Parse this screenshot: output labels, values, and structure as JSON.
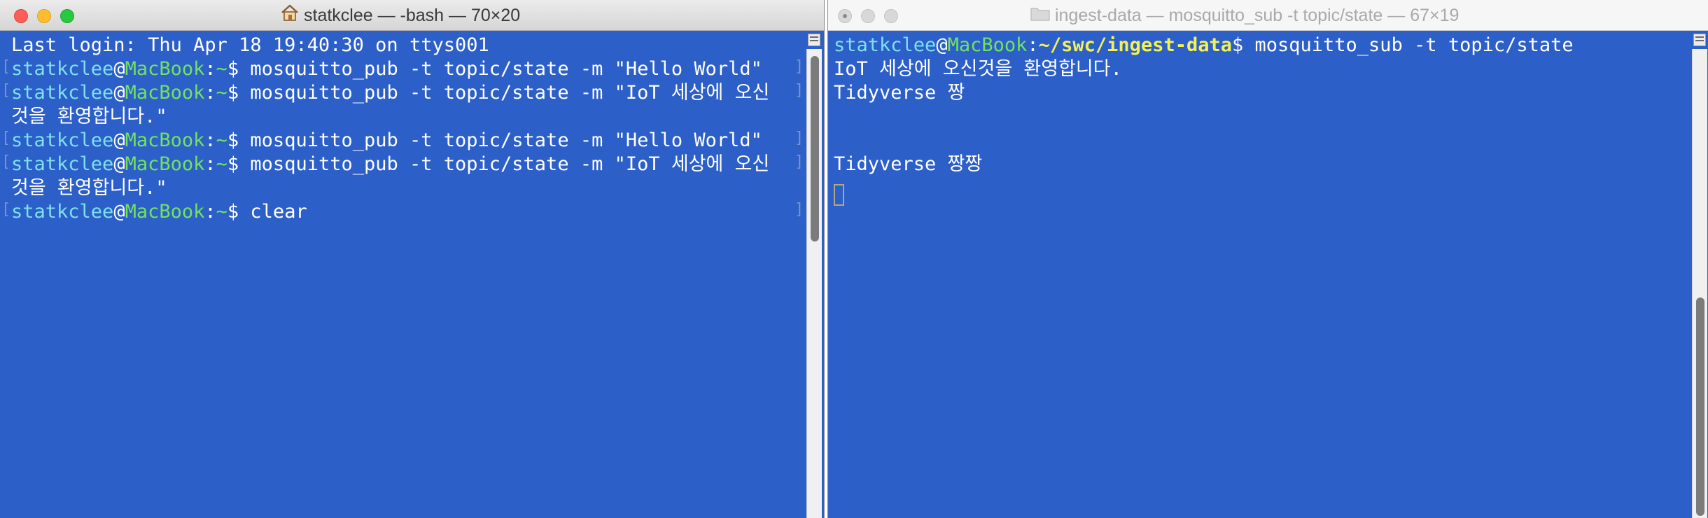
{
  "left_window": {
    "title": "statkclee — -bash — 70×20",
    "title_icon": "home-icon",
    "lines": [
      {
        "type": "text",
        "text": "Last login: Thu Apr 18 19:40:30 on ttys001"
      },
      {
        "type": "prompt",
        "user": "statkclee",
        "at": "@",
        "host": "MacBook",
        "colon": ":",
        "path": "~",
        "dollar": "$ ",
        "cmd": "mosquitto_pub -t topic/state -m \"Hello World\""
      },
      {
        "type": "prompt",
        "user": "statkclee",
        "at": "@",
        "host": "MacBook",
        "colon": ":",
        "path": "~",
        "dollar": "$ ",
        "cmd": "mosquitto_pub -t topic/state -m \"IoT 세상에 오신"
      },
      {
        "type": "text",
        "text": "것을 환영합니다.\""
      },
      {
        "type": "prompt",
        "user": "statkclee",
        "at": "@",
        "host": "MacBook",
        "colon": ":",
        "path": "~",
        "dollar": "$ ",
        "cmd": "mosquitto_pub -t topic/state -m \"Hello World\""
      },
      {
        "type": "prompt",
        "user": "statkclee",
        "at": "@",
        "host": "MacBook",
        "colon": ":",
        "path": "~",
        "dollar": "$ ",
        "cmd": "mosquitto_pub -t topic/state -m \"IoT 세상에 오신"
      },
      {
        "type": "text",
        "text": "것을 환영합니다.\""
      },
      {
        "type": "prompt",
        "user": "statkclee",
        "at": "@",
        "host": "MacBook",
        "colon": ":",
        "path": "~",
        "dollar": "$ ",
        "cmd": "clear"
      }
    ],
    "scroll_position": 0.0
  },
  "right_window": {
    "title": "ingest-data — mosquitto_sub -t topic/state — 67×19",
    "title_icon": "folder-icon",
    "lines": [
      {
        "type": "prompt",
        "user": "statkclee",
        "at": "@",
        "host": "MacBook",
        "colon": ":",
        "path": "~/swc/ingest-data",
        "dollar": "$ ",
        "cmd": "mosquitto_sub -t topic/state"
      },
      {
        "type": "text",
        "text": "IoT 세상에 오신것을 환영합니다."
      },
      {
        "type": "text",
        "text": "Tidyverse 짱"
      },
      {
        "type": "text",
        "text": ""
      },
      {
        "type": "text",
        "text": ""
      },
      {
        "type": "text",
        "text": "Tidyverse 짱짱"
      }
    ],
    "scroll_position": 1.0
  },
  "colors": {
    "terminal_bg": "#2c5fc8",
    "text": "#ffffff",
    "user": "#7ee0ee",
    "host": "#72e35e",
    "path": "#f4f152"
  }
}
